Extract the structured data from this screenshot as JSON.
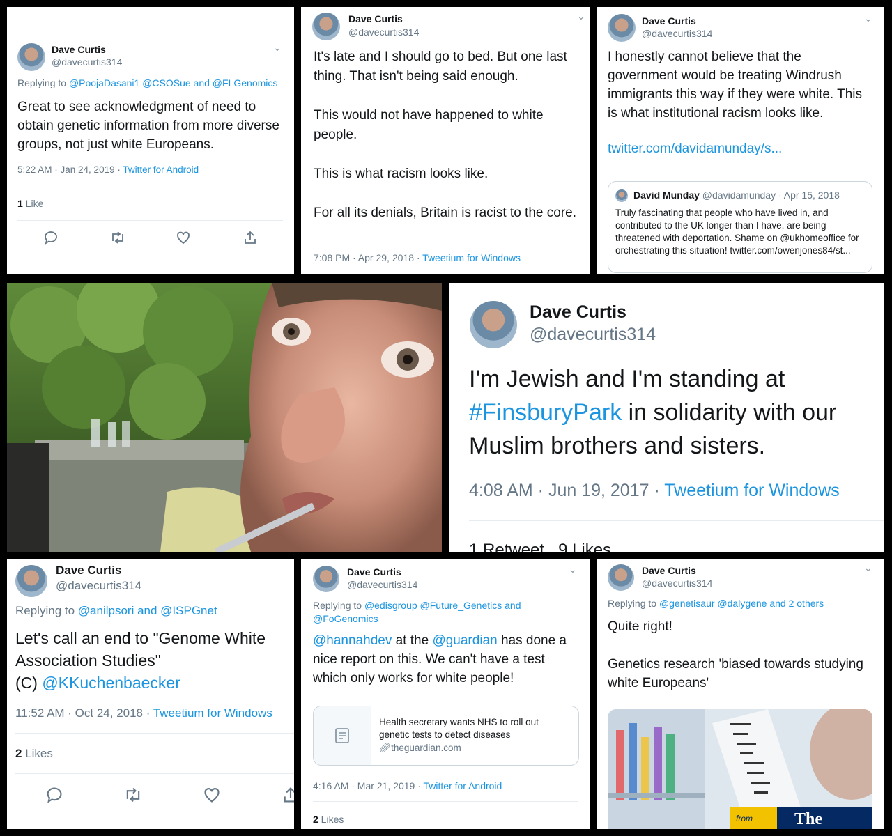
{
  "p1": {
    "name": "Dave Curtis",
    "handle": "@davecurtis314",
    "reply_prefix": "Replying to ",
    "reply_handles": "@PoojaDasani1 @CSOSue and @FLGenomics",
    "text": "Great to see acknowledgment of need to obtain genetic information from more diverse groups, not just white Europeans.",
    "time": "5:22 AM · Jan 24, 2019 · ",
    "source": "Twitter for Android",
    "like_count": "1",
    "like_label": " Like"
  },
  "p2": {
    "name": "Dave Curtis",
    "handle": "@davecurtis314",
    "line1": "It's late and I should go to bed. But one last thing. That isn't being said enough.",
    "line2": "This would not have happened to white people.",
    "line3": "This is what racism looks like.",
    "line4": "For all its denials, Britain is racist to the core.",
    "time": "7:08 PM · Apr 29, 2018 · ",
    "source": "Tweetium for Windows"
  },
  "p3": {
    "name": "Dave Curtis",
    "handle": "@davecurtis314",
    "text": "I honestly cannot believe that the government would be treating Windrush immigrants this way if they were white. This is what institutional racism looks like.",
    "link": "twitter.com/davidamunday/s...",
    "quote": {
      "name": "David Munday",
      "handle": "@davidamunday · Apr 15, 2018",
      "text": "Truly fascinating that people who have lived in, and contributed to the UK longer than I have, are being threatened with deportation. Shame on @ukhomeoffice for orchestrating this situation! twitter.com/owenjones84/st..."
    }
  },
  "p5": {
    "name": "Dave Curtis",
    "handle": "@davecurtis314",
    "text_a": "I'm Jewish and I'm standing at ",
    "hashtag": "#FinsburyPark",
    "text_b": " in solidarity with our Muslim brothers and sisters.",
    "time": "4:08 AM · Jun 19, 2017 · ",
    "source": "Tweetium for Windows",
    "stats": "1 Retweet   9 Likes"
  },
  "p6": {
    "name": "Dave Curtis",
    "handle": "@davecurtis314",
    "reply_prefix": "Replying to ",
    "reply_handles": "@anilpsori and @ISPGnet",
    "text": "Let's call an end to \"Genome White Association Studies\"",
    "text_c": "(C) ",
    "mention": "@KKuchenbaecker",
    "time": "11:52 AM · Oct 24, 2018 · ",
    "source": "Tweetium for Windows",
    "like_count": "2",
    "like_label": " Likes"
  },
  "p7": {
    "name": "Dave Curtis",
    "handle": "@davecurtis314",
    "reply_prefix": "Replying to ",
    "reply_handles": "@edisgroup @Future_Genetics and @FoGenomics",
    "mention1": "@hannahdev",
    "t1": " at the ",
    "mention2": "@guardian",
    "t2": " has done a nice report on this. We can't have a test which only works for white people!",
    "card_title": "Health secretary wants NHS to roll out genetic tests to detect diseases",
    "card_domain": "theguardian.com",
    "time": "4:16 AM · Mar 21, 2019 · ",
    "source": "Twitter for Android",
    "like_count": "2",
    "like_label": " Likes"
  },
  "p8": {
    "name": "Dave Curtis",
    "handle": "@davecurtis314",
    "reply_prefix": "Replying to ",
    "reply_handles": "@genetisaur @dalygene and 2 others",
    "line1": "Quite right!",
    "line2": "Genetics research 'biased towards studying white Europeans'",
    "img_from": "from",
    "img_brand": "The"
  },
  "colors": {
    "link": "#1b95e0",
    "muted": "#657786",
    "background": "#000000"
  }
}
